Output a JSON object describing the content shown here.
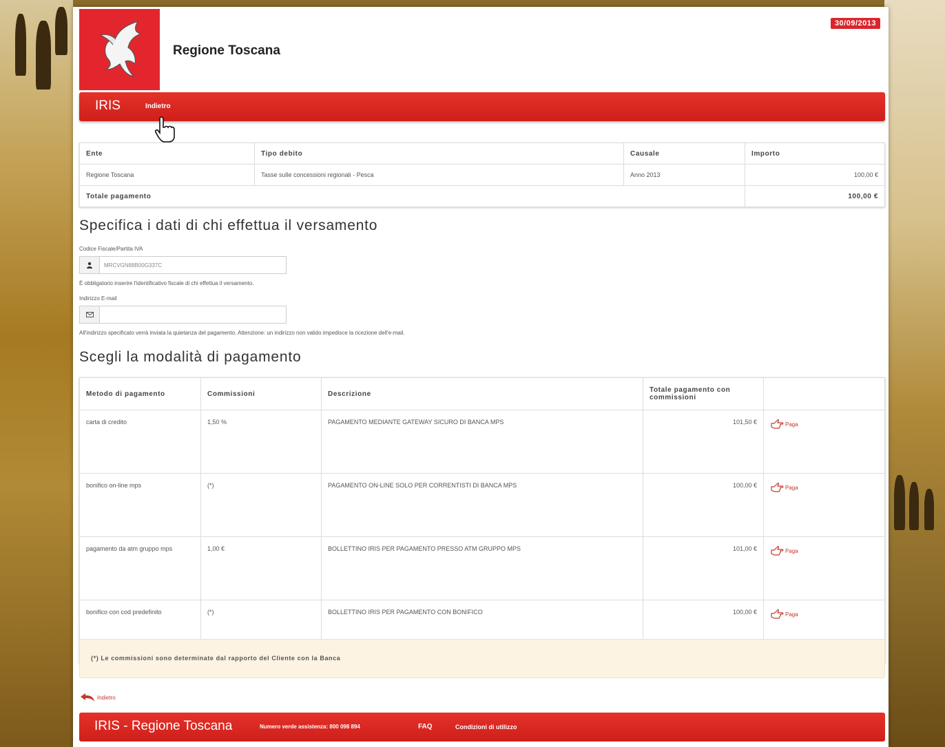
{
  "header": {
    "org_title": "Regione Toscana",
    "date": "30/09/2013"
  },
  "nav": {
    "brand": "IRIS",
    "back_label": "Indietro"
  },
  "debt_table": {
    "columns": [
      "Ente",
      "Tipo debito",
      "Causale",
      "Importo"
    ],
    "rows": [
      [
        "Regione Toscana",
        "Tasse sulle concessioni regionali - Pesca",
        "Anno 2013",
        "100,00 €"
      ]
    ],
    "total_label": "Totale pagamento",
    "total_value": "100,00 €"
  },
  "payer": {
    "title": "Specifica i dati di chi effettua il versamento",
    "fiscal_label": "Codice Fiscale/Partita IVA",
    "fiscal_value": "MRCVGN88B00G337C",
    "fiscal_help": "È obbligatorio inserire l'identificativo fiscale di chi effettua il versamento.",
    "email_label": "Indirizzo E-mail",
    "email_value": "",
    "email_help": "All'indirizzo specificato verrà inviata la quietanza del pagamento. Attenzione: un indirizzo non valido impedisce la ricezione dell'e-mail."
  },
  "payment": {
    "title": "Scegli la modalità di pagamento",
    "columns": [
      "Metodo di pagamento",
      "Commissioni",
      "Descrizione",
      "Totale pagamento con commissioni",
      ""
    ],
    "pay_label": "Paga",
    "rows": [
      {
        "method": "carta di credito",
        "commission": "1,50 %",
        "description": "PAGAMENTO MEDIANTE GATEWAY SICURO DI BANCA MPS",
        "total": "101,50 €"
      },
      {
        "method": "bonifico on-line mps",
        "commission": "(*)",
        "description": "PAGAMENTO ON-LINE SOLO PER CORRENTISTI DI BANCA MPS",
        "total": "100,00 €"
      },
      {
        "method": "pagamento da atm gruppo mps",
        "commission": "1,00 €",
        "description": "BOLLETTINO IRIS PER PAGAMENTO PRESSO ATM GRUPPO MPS",
        "total": "101,00 €"
      },
      {
        "method": "bonifico con cod predefinito",
        "commission": "(*)",
        "description": "BOLLETTINO IRIS PER PAGAMENTO CON BONIFICO",
        "total": "100,00 €"
      }
    ]
  },
  "note": "(*) Le commissioni sono determinate dal rapporto del Cliente con la Banca",
  "back_bottom": "Indietro",
  "footer": {
    "title": "IRIS - Regione Toscana",
    "phone": "Numero verde assistenza: 800 098 894",
    "faq": "FAQ",
    "terms": "Condizioni di utilizzo"
  },
  "colors": {
    "brand_red": "#d9262c",
    "note_bg": "#fcf3e3"
  }
}
